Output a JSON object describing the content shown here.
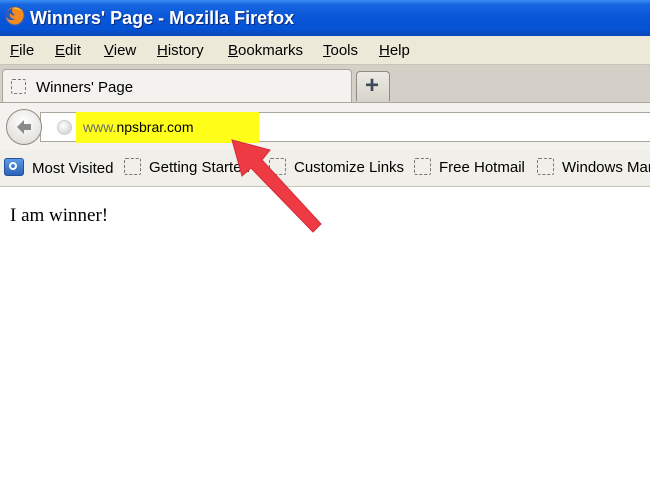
{
  "window": {
    "title": "Winners' Page - Mozilla Firefox"
  },
  "menu": [
    {
      "first": "F",
      "rest": "ile"
    },
    {
      "first": "E",
      "rest": "dit"
    },
    {
      "first": "V",
      "rest": "iew"
    },
    {
      "first": "H",
      "rest": "istory"
    },
    {
      "first": "B",
      "rest": "ookmarks"
    },
    {
      "first": "T",
      "rest": "ools"
    },
    {
      "first": "H",
      "rest": "elp"
    }
  ],
  "tab": {
    "label": "Winners' Page",
    "new_tab_symbol": "+"
  },
  "url": {
    "prefix": "www.",
    "domain": "npsbrar.com",
    "highlight_color": "#ffff1a"
  },
  "bookmarks": [
    "Most Visited",
    "Getting Started",
    "Customize Links",
    "Free Hotmail",
    "Windows Mar"
  ],
  "page": {
    "text": "I am winner!"
  },
  "annotation": {
    "arrow_color": "#ee3a43"
  }
}
